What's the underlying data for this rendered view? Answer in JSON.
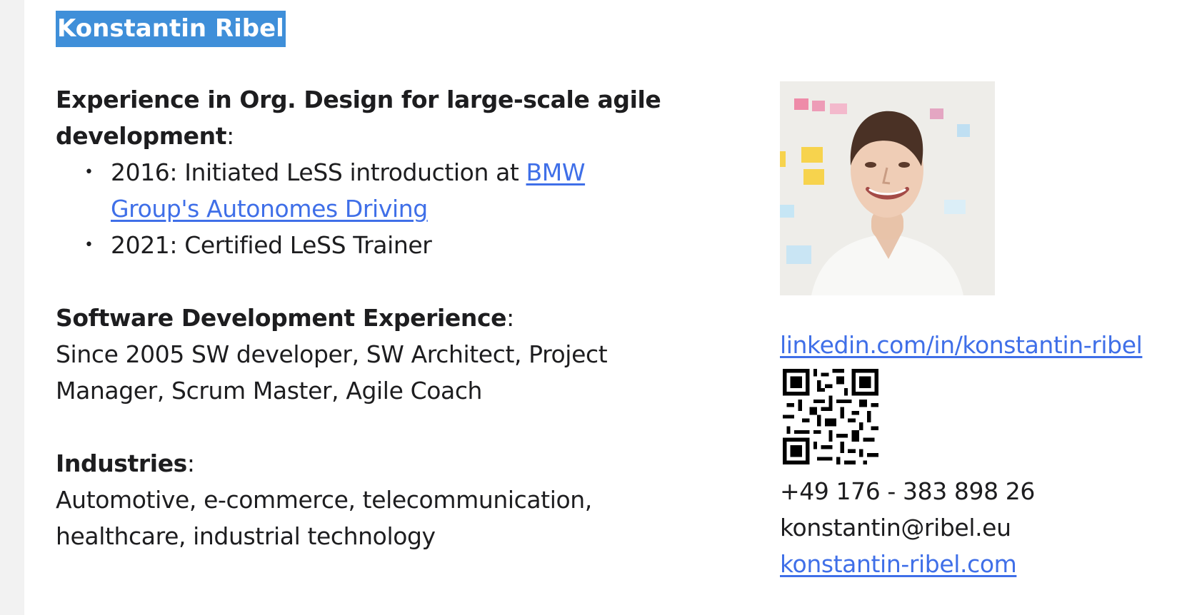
{
  "title": "Konstantin Ribel",
  "org_design": {
    "heading": "Experience in Org. Design for large-scale agile development",
    "colon": ":",
    "bullets": [
      {
        "bullet": "•",
        "prefix": "2016: Initiated LeSS introduction at ",
        "link": "BMW Group's Autonomes Driving"
      },
      {
        "bullet": "•",
        "text": "2021: Certified LeSS Trainer"
      }
    ]
  },
  "software": {
    "heading": "Software Development Experience",
    "colon": ":",
    "body": "Since 2005 SW developer, SW Architect, Project Manager, Scrum Master, Agile Coach"
  },
  "industries": {
    "heading": "Industries",
    "colon": ":",
    "body": "Automotive, e-commerce, telecommunication, healthcare, industrial technology"
  },
  "contact": {
    "linkedin": "linkedin.com/in/konstantin-ribel",
    "phone": "+49 176 - 383 898 26",
    "email": "konstantin@ribel.eu",
    "website": "konstantin-ribel.com"
  },
  "colors": {
    "highlight": "#3f8fd9",
    "link": "#3f6fe8",
    "text": "#1d1d1f",
    "sidebar": "#f2f2f2"
  }
}
